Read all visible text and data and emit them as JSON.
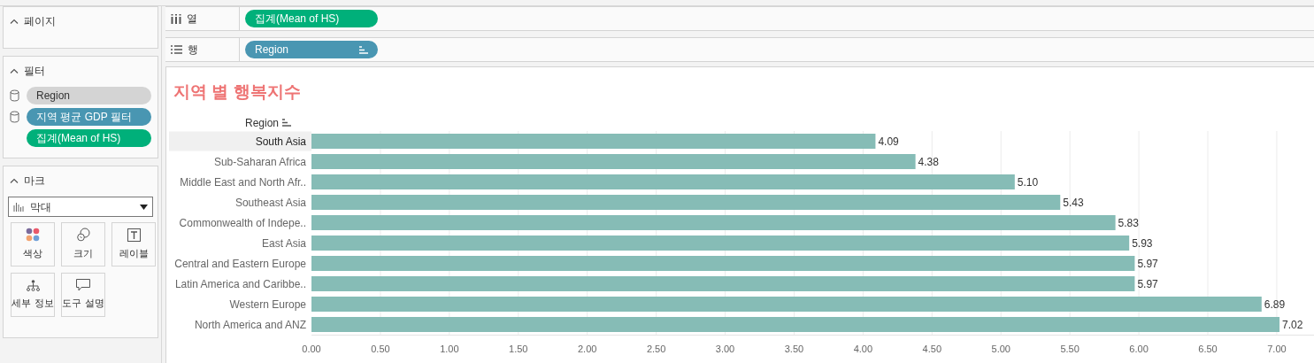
{
  "cards": {
    "pages": {
      "title": "페이지"
    },
    "filters": {
      "title": "필터",
      "items": [
        {
          "label": "Region",
          "color": "#d4d4d4",
          "kind": "dimension"
        },
        {
          "label": "지역 평균 GDP 필터",
          "color": "#4996b2",
          "kind": "dimension"
        },
        {
          "label": "집계(Mean of HS)",
          "color": "#00b07a",
          "kind": "measure"
        }
      ]
    },
    "marks": {
      "title": "마크",
      "mark_type": "막대",
      "buttons": [
        {
          "label": "색상",
          "kind": "color"
        },
        {
          "label": "크기",
          "kind": "size"
        },
        {
          "label": "레이블",
          "kind": "label"
        },
        {
          "label": "세부 정보",
          "kind": "detail"
        },
        {
          "label": "도구 설명",
          "kind": "tooltip"
        }
      ]
    }
  },
  "shelves": [
    {
      "label": "열",
      "kind": "columns",
      "pill": "집계(Mean of HS)",
      "color": "#00b07a",
      "sorted": false
    },
    {
      "label": "행",
      "kind": "rows",
      "pill": "Region",
      "color": "#4996b2",
      "sorted": true
    }
  ],
  "view": {
    "title": "지역 별 행복지수",
    "row_selected": [
      true,
      false,
      false,
      false,
      false,
      false,
      false,
      false,
      false,
      false
    ],
    "value_labels": [
      "4.09",
      "4.38",
      "5.10",
      "5.43",
      "5.83",
      "5.93",
      "5.97",
      "5.97",
      "6.89",
      "7.02"
    ],
    "chart_data": {
      "type": "bar",
      "orientation": "horizontal",
      "ylabel": "Region",
      "categories": [
        "South Asia",
        "Sub-Saharan Africa",
        "Middle East and North Afr..",
        "Southeast Asia",
        "Commonwealth of Indepe..",
        "East Asia",
        "Central and Eastern Europe",
        "Latin America and Caribbe..",
        "Western Europe",
        "North America and ANZ"
      ],
      "series": [
        {
          "color": "#86bcb6",
          "values": [
            4.09,
            4.38,
            5.1,
            5.43,
            5.83,
            5.93,
            5.97,
            5.97,
            6.89,
            7.02
          ]
        }
      ],
      "xlim": [
        0,
        7.27
      ],
      "grid": true,
      "xticks": [
        {
          "value": 0,
          "label": "0.00"
        },
        {
          "value": 0.5,
          "label": "0.50"
        },
        {
          "value": 1,
          "label": "1.00"
        },
        {
          "value": 1.5,
          "label": "1.50"
        },
        {
          "value": 2,
          "label": "2.00"
        },
        {
          "value": 2.5,
          "label": "2.50"
        },
        {
          "value": 3,
          "label": "3.00"
        },
        {
          "value": 3.5,
          "label": "3.50"
        },
        {
          "value": 4,
          "label": "4.00"
        },
        {
          "value": 4.5,
          "label": "4.50"
        },
        {
          "value": 5,
          "label": "5.00"
        },
        {
          "value": 5.5,
          "label": "5.50"
        },
        {
          "value": 6,
          "label": "6.00"
        },
        {
          "value": 6.5,
          "label": "6.50"
        },
        {
          "value": 7,
          "label": "7.00"
        }
      ]
    }
  }
}
